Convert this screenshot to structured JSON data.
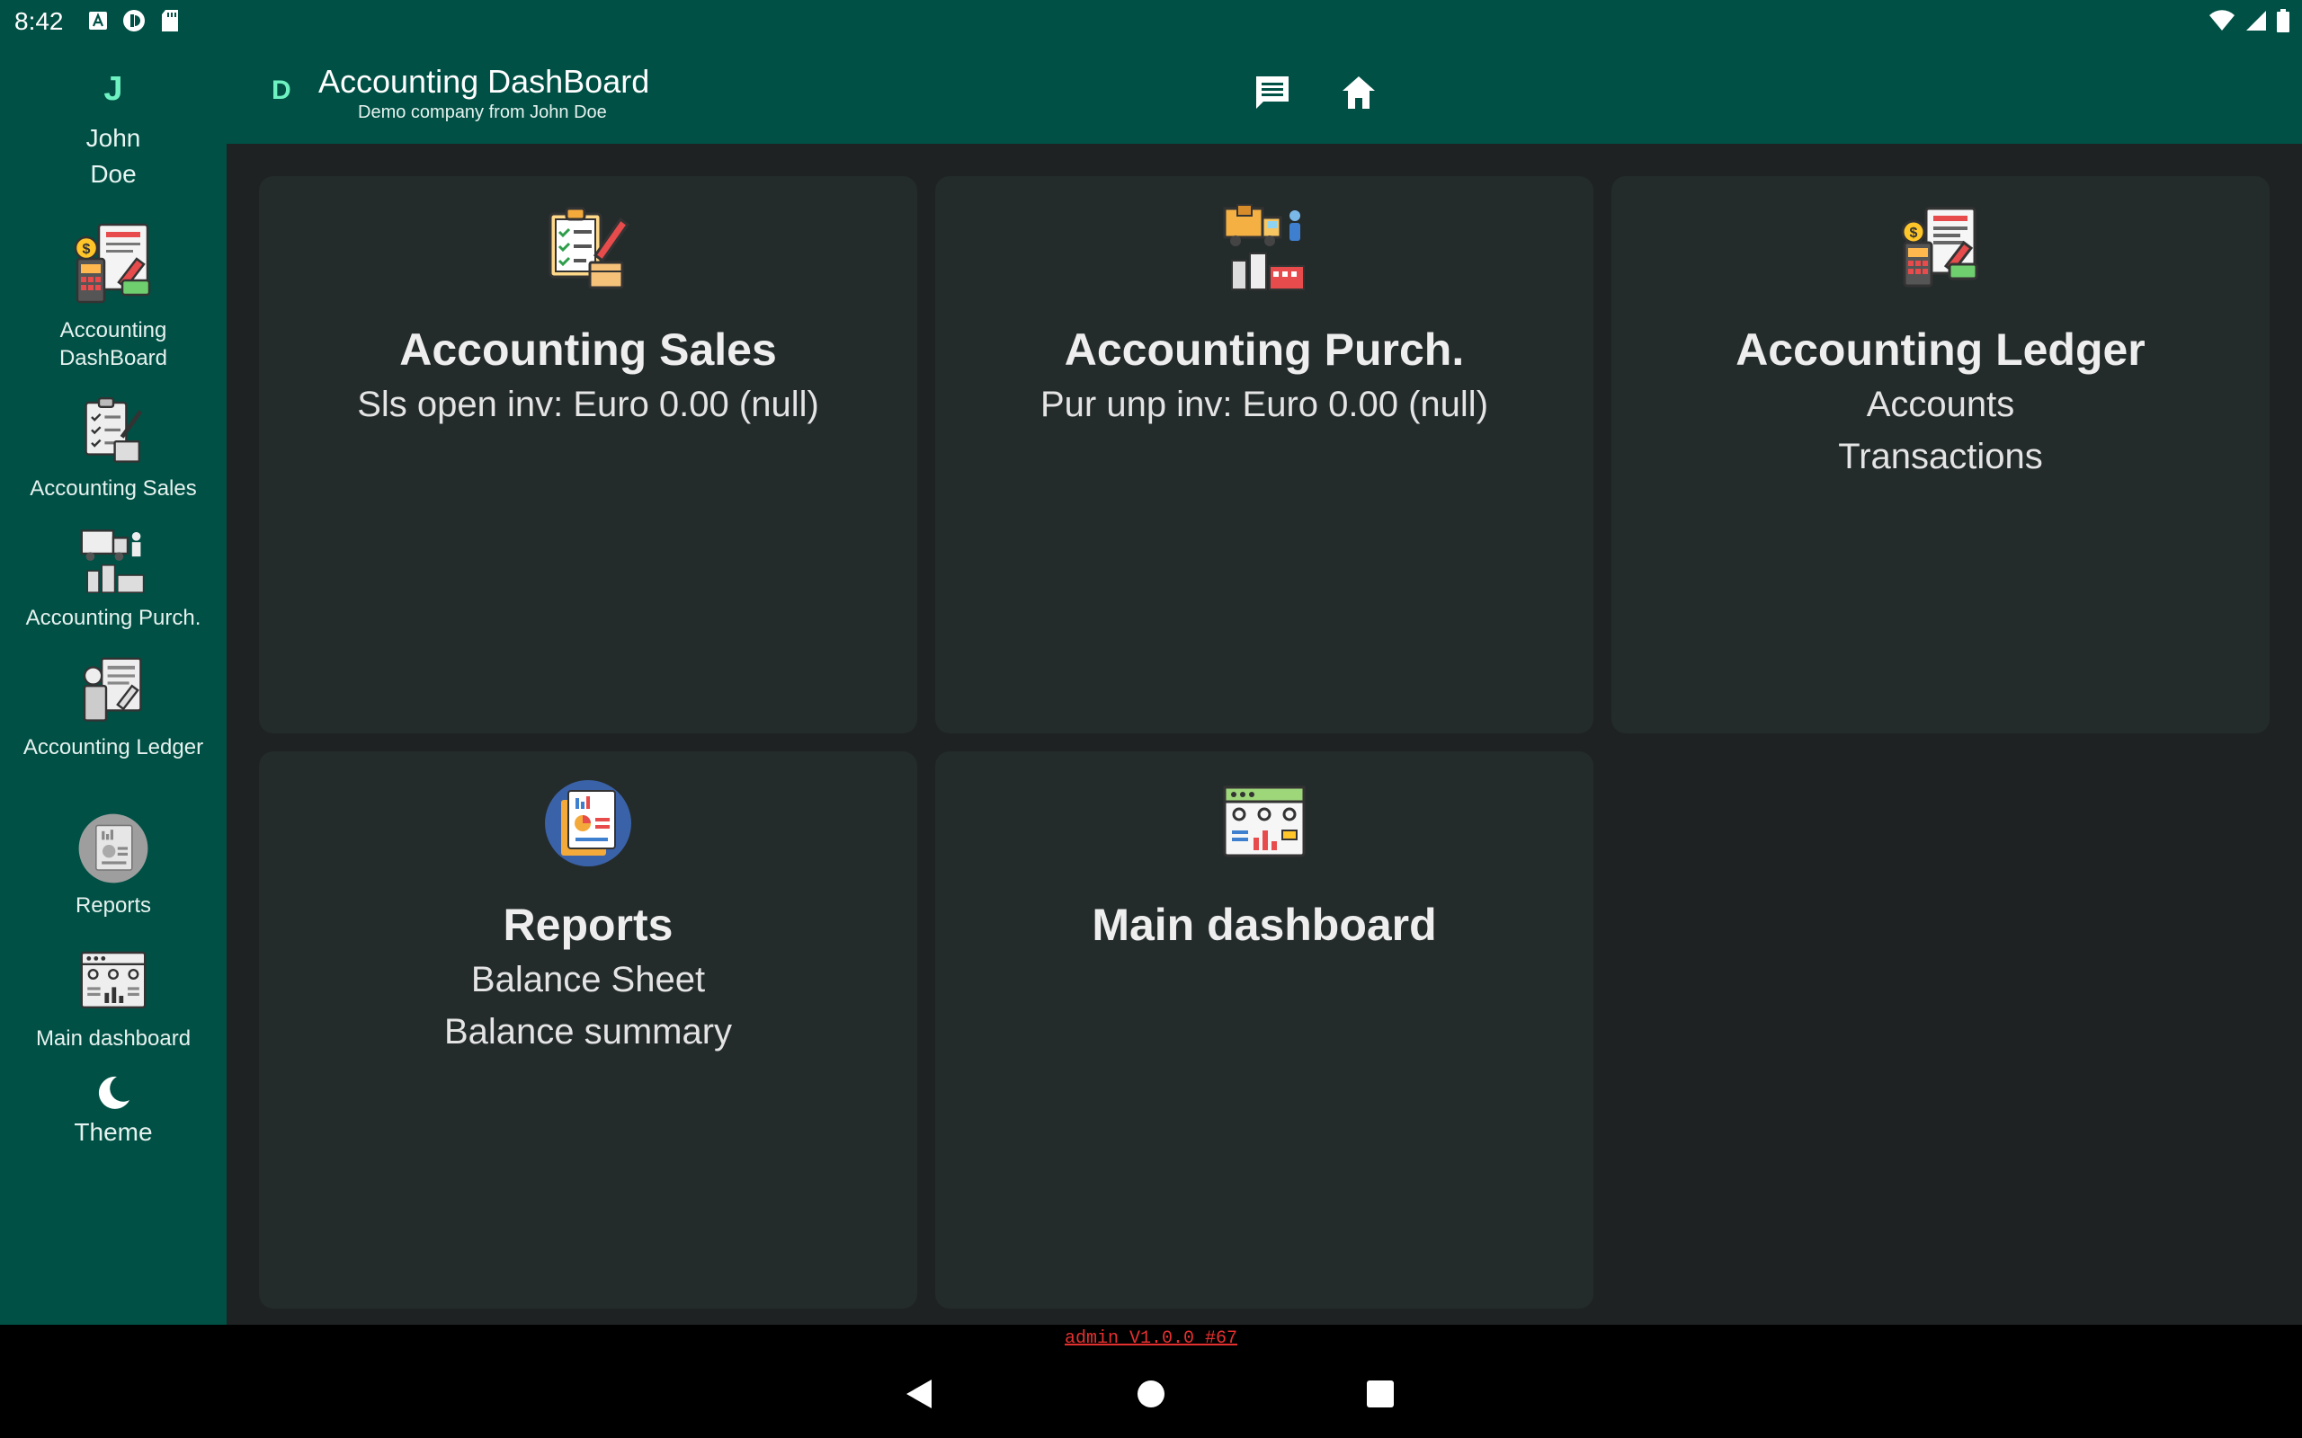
{
  "status_bar": {
    "time": "8:42"
  },
  "user": {
    "initial": "J",
    "name_line1": "John",
    "name_line2": "Doe"
  },
  "sidebar": {
    "items": [
      {
        "label_line1": "Accounting",
        "label_line2": "DashBoard"
      },
      {
        "label": "Accounting Sales"
      },
      {
        "label": "Accounting Purch."
      },
      {
        "label": "Accounting Ledger"
      },
      {
        "label": "Reports"
      },
      {
        "label": "Main dashboard"
      },
      {
        "label": "Theme"
      }
    ]
  },
  "header": {
    "company_initial": "D",
    "title": "Accounting DashBoard",
    "subtitle": "Demo company from John Doe"
  },
  "cards": [
    {
      "title": "Accounting Sales",
      "lines": [
        "Sls open inv: Euro 0.00 (null)"
      ]
    },
    {
      "title": "Accounting Purch.",
      "lines": [
        "Pur unp inv: Euro 0.00 (null)"
      ]
    },
    {
      "title": "Accounting Ledger",
      "lines": [
        "Accounts",
        "Transactions"
      ]
    },
    {
      "title": "Reports",
      "lines": [
        "Balance Sheet",
        "Balance summary"
      ]
    },
    {
      "title": "Main dashboard",
      "lines": []
    }
  ],
  "footer": {
    "version": "admin V1.0.0 #67"
  },
  "colors": {
    "primary": "#005045",
    "accent": "#6ef2c2",
    "background": "#1e2222",
    "card": "#242b2b",
    "version": "#e53030"
  },
  "icons": [
    "chat-icon",
    "home-icon",
    "moon-icon",
    "back-icon",
    "circle-home-icon",
    "recents-icon"
  ]
}
